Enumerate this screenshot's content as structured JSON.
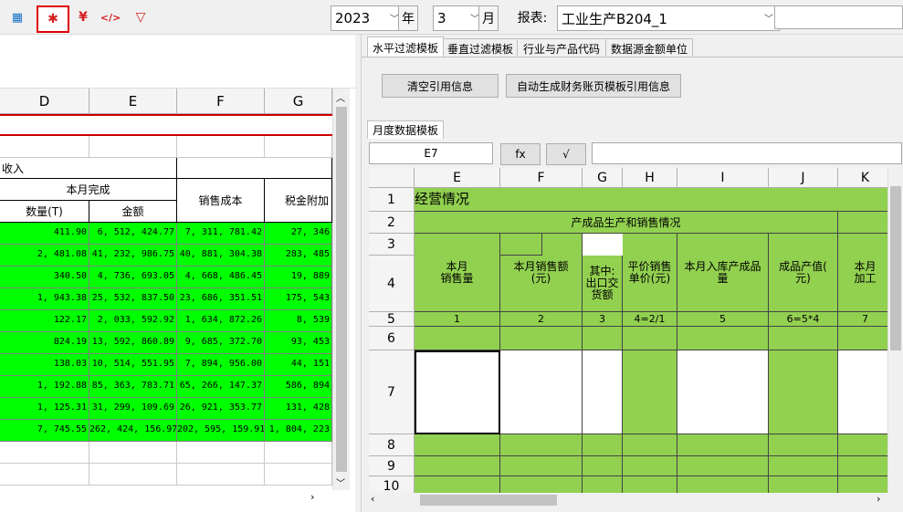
{
  "toolbar": {
    "icons": [
      "calculator-icon",
      "puzzle-icon",
      "yen-icon",
      "code-icon",
      "filter-icon"
    ],
    "year": "2023",
    "year_label": "年",
    "month": "3",
    "month_label": "月",
    "report_label": "报表:",
    "report_value": "工业生产B204_1"
  },
  "left": {
    "columns": [
      "D",
      "E",
      "F",
      "G"
    ],
    "title_fragment": "收入",
    "group_header": "本月完成",
    "sub_headers": [
      "数量(T)",
      "金额"
    ],
    "col_f_header": "销售成本",
    "col_g_header": "税金附加",
    "rows": [
      [
        "411.90",
        "6, 512, 424.77",
        "7, 311, 781.42",
        "27, 346"
      ],
      [
        "2, 481.08",
        "41, 232, 986.75",
        "40, 881, 304.38",
        "283, 485"
      ],
      [
        "340.50",
        "4, 736, 693.05",
        "4, 668, 486.45",
        "19, 889"
      ],
      [
        "1, 943.38",
        "25, 532, 837.50",
        "23, 686, 351.51",
        "175, 543"
      ],
      [
        "122.17",
        "2, 033, 592.92",
        "1, 634, 872.26",
        "8, 539"
      ],
      [
        "824.19",
        "13, 592, 860.89",
        "9, 685, 372.70",
        "93, 453"
      ],
      [
        "138.03",
        "10, 514, 551.95",
        "7, 894, 956.00",
        "44, 151"
      ],
      [
        "1, 192.88",
        "85, 363, 783.71",
        "65, 266, 147.37",
        "586, 894"
      ],
      [
        "1, 125.31",
        "31, 299, 109.69",
        "26, 921, 353.77",
        "131, 428"
      ],
      [
        "7, 745.55",
        "262, 424, 156.97",
        "202, 595, 159.91",
        "1, 804, 223"
      ]
    ]
  },
  "right": {
    "tabs": [
      "水平过滤模板",
      "垂直过滤模板",
      "行业与产品代码",
      "数据源金额单位"
    ],
    "clear_button": "清空引用信息",
    "auto_button": "自动生成财务账页模板引用信息",
    "sub_tab": "月度数据模板",
    "cell_ref": "E7",
    "fx_button": "fx",
    "check_button": "√",
    "formula_value": "",
    "columns": [
      "E",
      "F",
      "G",
      "H",
      "I",
      "J",
      "K"
    ],
    "row_numbers": [
      "1",
      "2",
      "3",
      "4",
      "5",
      "6",
      "7",
      "8",
      "9",
      "10"
    ],
    "row1_title": "经营情况",
    "row2_title": "产成品生产和销售情况",
    "headers": [
      "本月\n销售量",
      "本月销售额\n(元)",
      "其中:\n出口交\n货额",
      "平价销售\n单价(元)",
      "本月入库产成品\n量",
      "成品产值(\n元)",
      "本月\n加工"
    ],
    "formula_row": [
      "1",
      "2",
      "3",
      "4=2/1",
      "5",
      "6=5*4",
      "7"
    ]
  }
}
